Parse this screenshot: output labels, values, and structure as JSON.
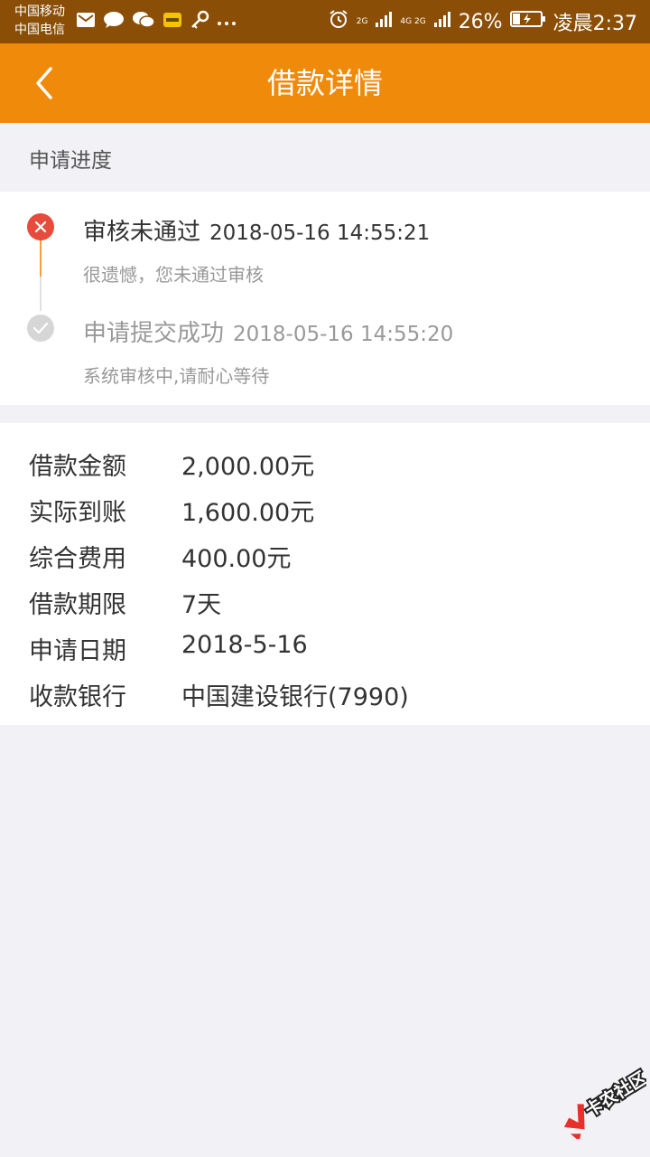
{
  "status_bar": {
    "carrier1": "中国移动",
    "carrier2": "中国电信",
    "network1": "2G",
    "network2": "4G 2G",
    "battery": "26%",
    "time": "凌晨2:37"
  },
  "header": {
    "title": "借款详情",
    "back_icon": "chevron-left-icon"
  },
  "progress": {
    "section_label": "申请进度",
    "steps": [
      {
        "title": "审核未通过",
        "time": "2018-05-16 14:55:21",
        "desc": "很遗憾，您未通过审核",
        "status": "rejected",
        "color": "#e64b3c"
      },
      {
        "title": "申请提交成功",
        "time": "2018-05-16 14:55:20",
        "desc": "系统审核中,请耐心等待",
        "status": "done",
        "color": "#d6d6d6"
      }
    ]
  },
  "details": [
    {
      "label": "借款金额",
      "value": "2,000.00元"
    },
    {
      "label": "实际到账",
      "value": "1,600.00元"
    },
    {
      "label": "综合费用",
      "value": "400.00元"
    },
    {
      "label": "借款期限",
      "value": "7天"
    },
    {
      "label": "申请日期",
      "value": "2018-5-16"
    },
    {
      "label": "收款银行",
      "value": "中国建设银行(7990)"
    }
  ],
  "watermark": {
    "text": "卡农社区"
  },
  "colors": {
    "header_bg": "#f08a0b",
    "status_bar_bg": "#8a4e06",
    "page_bg": "#f2f2f6",
    "reject_red": "#e64b3c",
    "timeline_orange": "#f0a040"
  }
}
